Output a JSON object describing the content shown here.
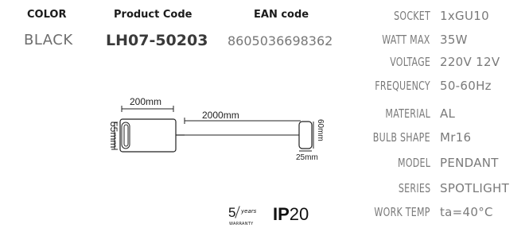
{
  "header": {
    "color_label": "COLOR",
    "code_label": "Product Code",
    "ean_label": "EAN code",
    "color_value": "BLACK",
    "code_value": "LH07-50203",
    "ean_value": "8605036698362"
  },
  "specs": [
    {
      "label": "SOCKET",
      "value": "1xGU10"
    },
    {
      "label": "WATT MAX",
      "value": "35W"
    },
    {
      "label": "VOLTAGE",
      "value": "220V 12V"
    },
    {
      "label": "FREQUENCY",
      "value": "50-60Hz"
    },
    {
      "label": "MATERIAL",
      "value": "AL"
    },
    {
      "label": "BULB SHAPE",
      "value": "Mr16"
    },
    {
      "label": "MODEL",
      "value": "PENDANT"
    },
    {
      "label": "SERIES",
      "value": "SPOTLIGHT"
    },
    {
      "label": "WORK TEMP",
      "value": "ta=40°C"
    }
  ],
  "drawing": {
    "length_label": "200mm",
    "cable_label": "2000mm",
    "height_label": "55mm",
    "canopy_height_label": "60mm",
    "canopy_width_label": "25mm"
  },
  "badges": {
    "warranty_number": "5",
    "warranty_unit": "years",
    "warranty_label": "WARRANTY",
    "ip_prefix": "IP",
    "ip_rating": "20"
  }
}
